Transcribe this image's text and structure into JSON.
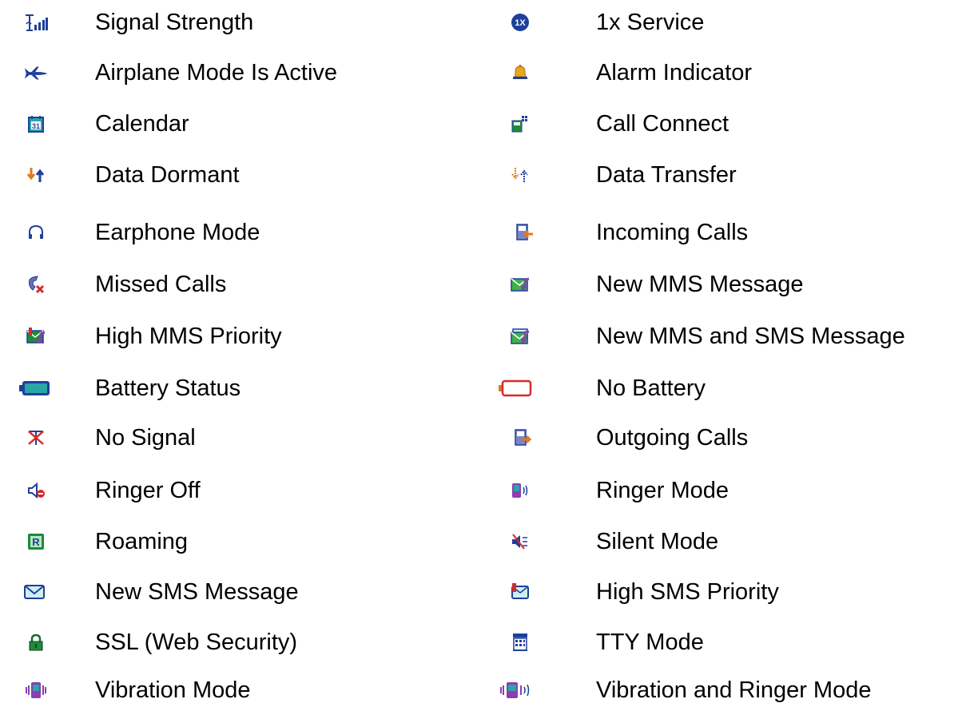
{
  "left_column": [
    {
      "icon": "signal-strength-icon",
      "label": "Signal Strength"
    },
    {
      "icon": "airplane-icon",
      "label": "Airplane Mode Is Active"
    },
    {
      "icon": "calendar-icon",
      "label": "Calendar"
    },
    {
      "icon": "data-dormant-icon",
      "label": "Data Dormant"
    },
    {
      "icon": "earphone-icon",
      "label": "Earphone Mode"
    },
    {
      "icon": "missed-calls-icon",
      "label": "Missed Calls"
    },
    {
      "icon": "high-mms-priority-icon",
      "label": "High MMS Priority"
    },
    {
      "icon": "battery-status-icon",
      "label": "Battery Status"
    },
    {
      "icon": "no-signal-icon",
      "label": "No Signal"
    },
    {
      "icon": "ringer-off-icon",
      "label": "Ringer Off"
    },
    {
      "icon": "roaming-icon",
      "label": "Roaming"
    },
    {
      "icon": "sms-envelope-icon",
      "label": "New SMS Message"
    },
    {
      "icon": "padlock-icon",
      "label": "SSL (Web Security)"
    },
    {
      "icon": "vibration-icon",
      "label": "Vibration Mode"
    }
  ],
  "right_column": [
    {
      "icon": "1x-service-icon",
      "label": "1x Service"
    },
    {
      "icon": "alarm-bell-icon",
      "label": "Alarm Indicator"
    },
    {
      "icon": "call-connect-icon",
      "label": "Call Connect"
    },
    {
      "icon": "data-transfer-icon",
      "label": "Data Transfer"
    },
    {
      "icon": "incoming-calls-icon",
      "label": "Incoming Calls"
    },
    {
      "icon": "new-mms-icon",
      "label": "New MMS Message"
    },
    {
      "icon": "new-mms-sms-icon",
      "label": "New MMS and SMS Message"
    },
    {
      "icon": "no-battery-icon",
      "label": "No Battery"
    },
    {
      "icon": "outgoing-calls-icon",
      "label": "Outgoing Calls"
    },
    {
      "icon": "ringer-mode-icon",
      "label": "Ringer Mode"
    },
    {
      "icon": "silent-mode-icon",
      "label": "Silent Mode"
    },
    {
      "icon": "high-sms-priority-icon",
      "label": "High SMS Priority"
    },
    {
      "icon": "tty-icon",
      "label": "TTY Mode"
    },
    {
      "icon": "vibration-ringer-icon",
      "label": "Vibration and Ringer Mode"
    }
  ],
  "colors": {
    "text": "#000000",
    "blue": "#1f3f9a",
    "teal": "#2aa6a6",
    "orange": "#e07a1e",
    "red": "#d8282a",
    "purple": "#8a3fb0",
    "green": "#1e8a3a"
  }
}
